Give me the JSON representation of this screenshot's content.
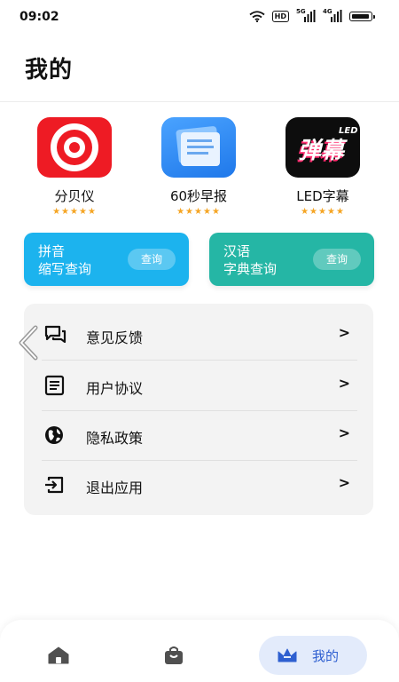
{
  "status_bar": {
    "time": "09:02",
    "hd_label": "HD",
    "network_1": "5G",
    "network_2": "4G"
  },
  "header": {
    "title": "我的"
  },
  "apps": [
    {
      "name": "分贝仪",
      "rating": "★★★★★",
      "icon": "decibel-meter-icon",
      "color": "#ee1b24"
    },
    {
      "name": "60秒早报",
      "rating": "★★★★★",
      "icon": "news-document-icon",
      "color": "#2b87f0"
    },
    {
      "name": "LED字幕",
      "rating": "★★★★★",
      "icon": "led-subtitle-icon",
      "icon_text": "弹幕",
      "icon_tag": "LED",
      "color": "#0d0d0d"
    }
  ],
  "query_cards": [
    {
      "line1": "拼音",
      "line2": "缩写查询",
      "button": "查询",
      "color": "#1cb3ee"
    },
    {
      "line1": "汉语",
      "line2": "字典查询",
      "button": "查询",
      "color": "#25b6a5"
    }
  ],
  "menu": [
    {
      "label": "意见反馈",
      "icon": "feedback-chat-icon",
      "arrow": ">"
    },
    {
      "label": "用户协议",
      "icon": "document-list-icon",
      "arrow": ">"
    },
    {
      "label": "隐私政策",
      "icon": "globe-icon",
      "arrow": ">"
    },
    {
      "label": "退出应用",
      "icon": "exit-icon",
      "arrow": ">"
    }
  ],
  "bottom_nav": {
    "items": [
      {
        "icon": "home-icon",
        "label": ""
      },
      {
        "icon": "store-bag-icon",
        "label": ""
      },
      {
        "icon": "crown-icon",
        "label": "我的",
        "active": true
      }
    ],
    "accent": "#2e5fd0"
  }
}
